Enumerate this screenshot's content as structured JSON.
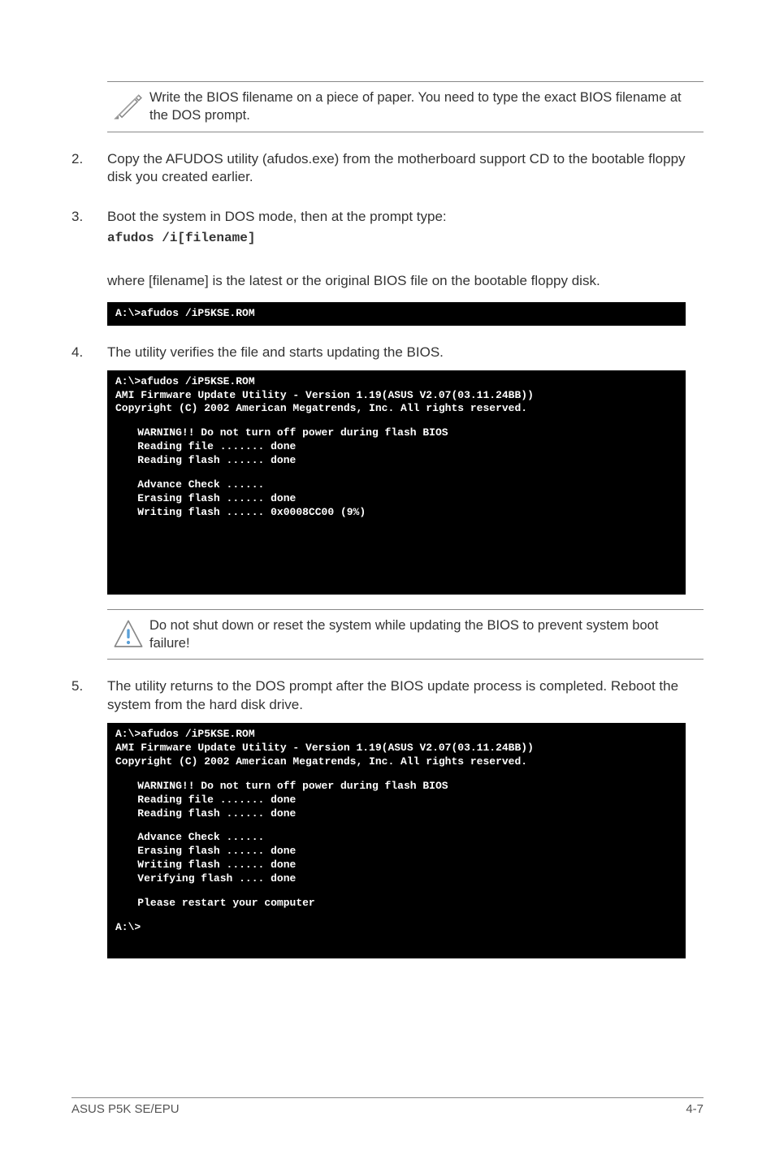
{
  "note": {
    "text": "Write the BIOS filename on a piece of paper. You need to type the exact BIOS filename at the DOS prompt."
  },
  "step2": {
    "num": "2.",
    "text": "Copy the AFUDOS utility (afudos.exe) from the motherboard support CD to the bootable floppy disk you created earlier."
  },
  "step3": {
    "num": "3.",
    "text": "Boot the system in DOS mode, then at the prompt type:",
    "cmd": "afudos /i[filename]"
  },
  "step3_post": "where [filename] is the latest or the original BIOS file on the bootable floppy disk.",
  "term1": {
    "l1": "A:\\>afudos /iP5KSE.ROM"
  },
  "step4": {
    "num": "4.",
    "text": "The utility verifies the file and starts updating the BIOS."
  },
  "term2": {
    "l1": "A:\\>afudos /iP5KSE.ROM",
    "l2": "AMI Firmware Update Utility - Version 1.19(ASUS V2.07(03.11.24BB))",
    "l3": "Copyright (C) 2002 American Megatrends, Inc. All rights reserved.",
    "l4": "WARNING!! Do not turn off power during flash BIOS",
    "l5": "Reading file ....... done",
    "l6": "Reading flash ...... done",
    "l7": "Advance Check ......",
    "l8": "Erasing flash ...... done",
    "l9": "Writing flash ...... 0x0008CC00 (9%)"
  },
  "warn": {
    "text": "Do not shut down or reset the system while updating the BIOS to prevent system boot failure!"
  },
  "step5": {
    "num": "5.",
    "text": "The utility returns to the DOS prompt after the BIOS update process is completed. Reboot the system from the hard disk drive."
  },
  "term3": {
    "l1": "A:\\>afudos /iP5KSE.ROM",
    "l2": "AMI Firmware Update Utility - Version 1.19(ASUS V2.07(03.11.24BB))",
    "l3": "Copyright (C) 2002 American Megatrends, Inc. All rights reserved.",
    "l4": "WARNING!! Do not turn off power during flash BIOS",
    "l5": "Reading file ....... done",
    "l6": "Reading flash ...... done",
    "l7": "Advance Check ......",
    "l8": "Erasing flash ...... done",
    "l9": "Writing flash ...... done",
    "l10": "Verifying flash .... done",
    "l11": "Please restart your computer",
    "l12": "A:\\>"
  },
  "footer": {
    "left": "ASUS P5K SE/EPU",
    "right": "4-7"
  }
}
